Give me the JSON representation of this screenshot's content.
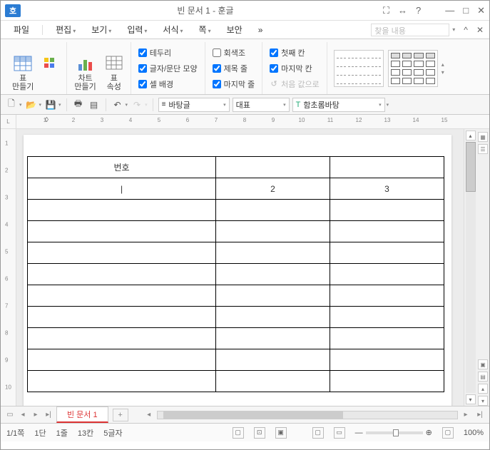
{
  "title": "빈 문서 1 - 훈글",
  "logo": "호",
  "menu": {
    "file": "파일",
    "edit": "편집",
    "view": "보기",
    "input": "입력",
    "format": "서식",
    "page": "쪽",
    "security": "보안",
    "more": "»",
    "search_placeholder": "찾을 내용"
  },
  "ribbon": {
    "make_table": "표\n만들기",
    "pivot": "",
    "chart": "차트\n만들기",
    "table_props": "표\n속성",
    "chk_border": "테두리",
    "chk_charpar": "글자/문단 모양",
    "chk_cellbg": "셀 배경",
    "chk_gray": "회색조",
    "chk_titlerow": "제목 줄",
    "chk_lastrow": "마지막 줄",
    "chk_firstcol": "첫째 칸",
    "chk_lastcol": "마지막 칸",
    "reset_btn": "처음 값으로"
  },
  "qat": {
    "style": "바탕글",
    "rep": "대표",
    "font": "함초롬바탕"
  },
  "document": {
    "table": {
      "header": [
        "번호",
        "",
        ""
      ],
      "row2": [
        "|",
        "2",
        "3"
      ]
    },
    "tab_name": "빈 문서 1"
  },
  "status": {
    "page": "1/1쪽",
    "section": "1단",
    "line": "1줄",
    "col": "13칸",
    "chars": "5글자",
    "zoom": "100%"
  },
  "ruler_nums_h": [
    "1",
    "2",
    "3",
    "4",
    "5",
    "6",
    "7",
    "8",
    "9",
    "10",
    "11",
    "12",
    "13",
    "14",
    "15"
  ],
  "ruler_nums_v": [
    "1",
    "2",
    "3",
    "4",
    "5",
    "6",
    "7",
    "8",
    "9",
    "10"
  ]
}
